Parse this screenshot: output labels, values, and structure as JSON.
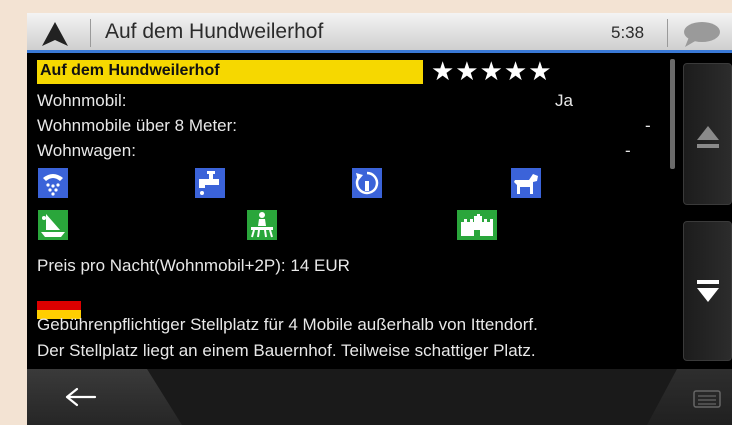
{
  "header": {
    "title": "Auf dem Hundweilerhof",
    "time": "5:38"
  },
  "place": {
    "name": "Auf dem Hundweilerhof",
    "rating_stars": "★★★★★",
    "rating": 5
  },
  "attributes": [
    {
      "label": "Wohnmobil:",
      "value": "Ja"
    },
    {
      "label": "Wohnmobile über 8 Meter:",
      "value": "-"
    },
    {
      "label": "Wohnwagen:",
      "value": "-"
    }
  ],
  "price": "Preis pro Nacht(Wohnmobil+2P): 14 EUR",
  "description": [
    "Gebührenpflichtiger Stellplatz für 4 Mobile außerhalb von Ittendorf.",
    "Der Stellplatz liegt an einem Bauernhof. Teilweise schattiger Platz."
  ],
  "amenity_icons": [
    "shower-icon",
    "water-tap-icon",
    "dump-station-icon",
    "dog-icon",
    "boat-icon",
    "picnic-icon",
    "castle-icon"
  ],
  "flag_colors": [
    "#000000",
    "#dd0000",
    "#ffce00"
  ],
  "colors": {
    "header_accent": "#3a79d6",
    "name_highlight": "#f6d800",
    "blue_icon": "#3b63d9",
    "green_icon": "#2aa63b"
  }
}
